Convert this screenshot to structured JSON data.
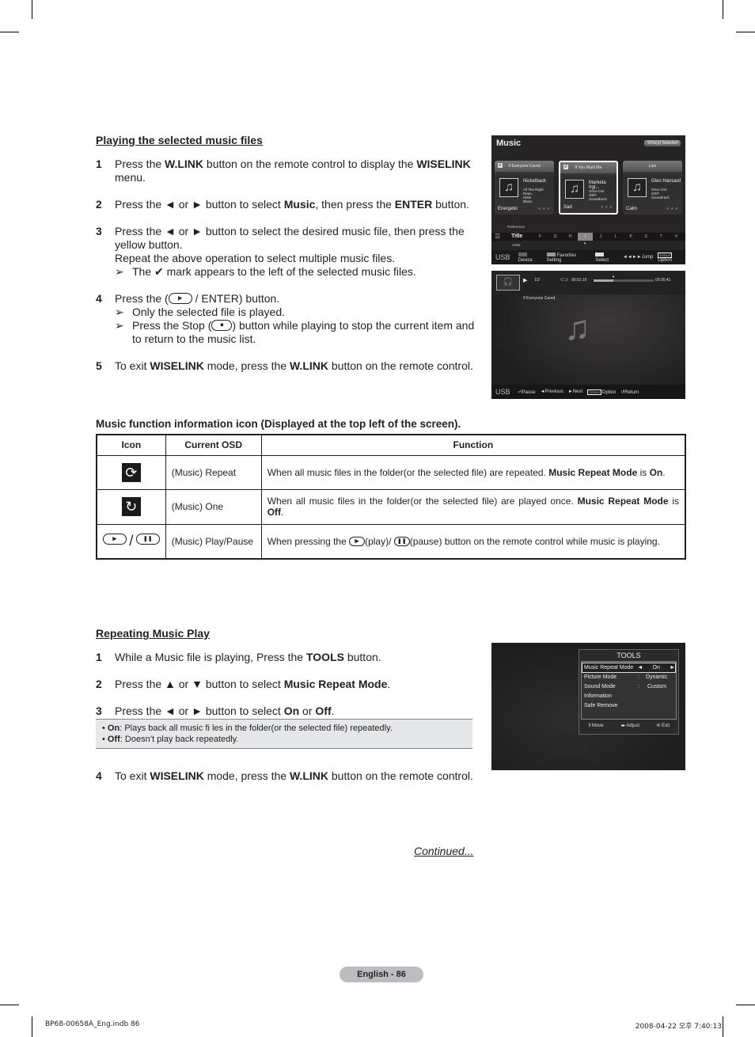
{
  "section1": {
    "title": "Playing the selected music files",
    "steps": [
      {
        "num": "1",
        "parts": [
          [
            "",
            "Press the "
          ],
          [
            "b",
            "W.LINK"
          ],
          [
            "",
            " button on the remote control to display the "
          ],
          [
            "b",
            "WISELINK"
          ],
          [
            "",
            " menu."
          ]
        ]
      },
      {
        "num": "2",
        "parts": [
          [
            "",
            "Press the ◄ or ► button to select "
          ],
          [
            "b",
            "Music"
          ],
          [
            "",
            ", then press the "
          ],
          [
            "b",
            "ENTER"
          ],
          [
            "",
            " button."
          ]
        ]
      },
      {
        "num": "3",
        "parts": [
          [
            "",
            "Press the ◄ or ► button to select the desired music file, then press the yellow button."
          ]
        ],
        "extra": "Repeat the above operation to select multiple music files.",
        "notes": [
          "The ✔ mark appears to the left of the selected music files."
        ]
      },
      {
        "num": "4",
        "text_a": "Press the (",
        "text_b": " / ENTER) button.",
        "notes": [
          "Only the selected file is played."
        ],
        "stop_note_a": "Press the Stop (",
        "stop_note_b": ") button while playing to stop the current item and to return to the music list."
      },
      {
        "num": "5",
        "parts": [
          [
            "",
            "To exit "
          ],
          [
            "b",
            "WISELINK"
          ],
          [
            "",
            " mode, press the "
          ],
          [
            "b",
            "W.LINK"
          ],
          [
            "",
            " button on the remote control."
          ]
        ]
      }
    ]
  },
  "screen1": {
    "title": "Music",
    "badge": "2File(s) Selected",
    "cards": [
      {
        "title": "If Everyone Cared",
        "checked": true,
        "artist": "Nickelback",
        "meta": [
          "All The Right Reas..",
          "2005",
          "Blues"
        ],
        "mood": "Energetic",
        "selected": false
      },
      {
        "title": "If You Want Me",
        "checked": true,
        "artist": "Marketa Irgl...",
        "meta": [
          "Once-Ost",
          "2007",
          "Soundtrack"
        ],
        "mood": "Sad",
        "selected": true
      },
      {
        "title": "Lies",
        "checked": false,
        "artist": "Glen Hansard",
        "meta": [
          "Once Ost",
          "2007",
          "Soundtrack"
        ],
        "mood": "Calm",
        "selected": false
      }
    ],
    "sort": {
      "above": "Preference",
      "current": "Title",
      "below": "Artist"
    },
    "letters": [
      "F",
      "G",
      "H",
      "I",
      "J",
      "L",
      "P",
      "S",
      "T",
      "V"
    ],
    "active_letter": "I",
    "bottom": {
      "source": "USB",
      "device": "Device",
      "favorites": "Favorites Setting",
      "select": "Select",
      "jump": "Jump",
      "tools": "TOOLS",
      "option": "Option"
    }
  },
  "screen2": {
    "track_index": "1/2",
    "elapsed": "00:01:15",
    "total": "00:05:41",
    "progress": 0.33,
    "track_title": "If Everyone Cared",
    "bottom": {
      "source": "USB",
      "pause": "Pause",
      "previous": "Previous",
      "next": "Next",
      "tools": "TOOLS",
      "option": "Option",
      "return": "Return"
    }
  },
  "table_section": {
    "title": "Music function information icon (Displayed at the top left of the screen).",
    "headers": [
      "Icon",
      "Current OSD",
      "Function"
    ],
    "rows": [
      {
        "icon": "repeat-all-icon",
        "osd": "(Music) Repeat",
        "fn_a": "When all music files in the folder(or the selected file) are repeated. ",
        "fn_b": "Music Repeat Mode",
        "fn_c": " is ",
        "fn_d": "On",
        "fn_e": "."
      },
      {
        "icon": "repeat-one-icon",
        "osd": "(Music) One",
        "fn_a": "When all music files in the folder(or the selected file) are played once. ",
        "fn_b": "Music Repeat Mode",
        "fn_c": " is ",
        "fn_d": "Off",
        "fn_e": "."
      },
      {
        "icon": "play-pause-icon",
        "osd": "(Music) Play/Pause",
        "fn_a": "When pressing the ",
        "fn_play": "(play)/ ",
        "fn_pause": "(pause) button on the remote control while music is playing."
      }
    ]
  },
  "section2": {
    "title": "Repeating Music Play",
    "steps": [
      {
        "num": "1",
        "parts": [
          [
            "",
            "While a Music file is playing, Press the "
          ],
          [
            "b",
            "TOOLS"
          ],
          [
            "",
            " button."
          ]
        ]
      },
      {
        "num": "2",
        "parts": [
          [
            "",
            "Press the ▲ or ▼ button to select "
          ],
          [
            "b",
            "Music Repeat Mode"
          ],
          [
            "",
            "."
          ]
        ]
      },
      {
        "num": "3",
        "parts": [
          [
            "",
            "Press the ◄ or ► button to select "
          ],
          [
            "b",
            "On"
          ],
          [
            "",
            " or "
          ],
          [
            "b",
            "Off"
          ],
          [
            "",
            "."
          ]
        ]
      },
      {
        "num": "4",
        "parts": [
          [
            "",
            "To exit "
          ],
          [
            "b",
            "WISELINK"
          ],
          [
            "",
            " mode, press the "
          ],
          [
            "b",
            "W.LINK"
          ],
          [
            "",
            " button on the remote control."
          ]
        ]
      }
    ],
    "notes": [
      {
        "term": "On",
        "text": ": Plays back all music fi les in the folder(or the selected file) repeatedly."
      },
      {
        "term": "Off",
        "text": ": Doesn’t play back repeatedly."
      }
    ]
  },
  "screen3": {
    "title": "TOOLS",
    "items": [
      {
        "label": "Music Repeat Mode",
        "sep": "◄",
        "value": "On",
        "end": "►",
        "selected": true
      },
      {
        "label": "Picture Mode",
        "sep": ":",
        "value": "Dynamic"
      },
      {
        "label": "Sound Mode",
        "sep": ":",
        "value": "Custom"
      },
      {
        "label": "Information"
      },
      {
        "label": "Safe Remove"
      }
    ],
    "footer": {
      "move": "Move",
      "adjust": "Adjust",
      "exit": "Exit"
    }
  },
  "continued": "Continued...",
  "page_label": "English - 86",
  "footer_left": "BP68-00658A_Eng.indb   86",
  "footer_right": "2008-04-22   오후 7:40:13"
}
